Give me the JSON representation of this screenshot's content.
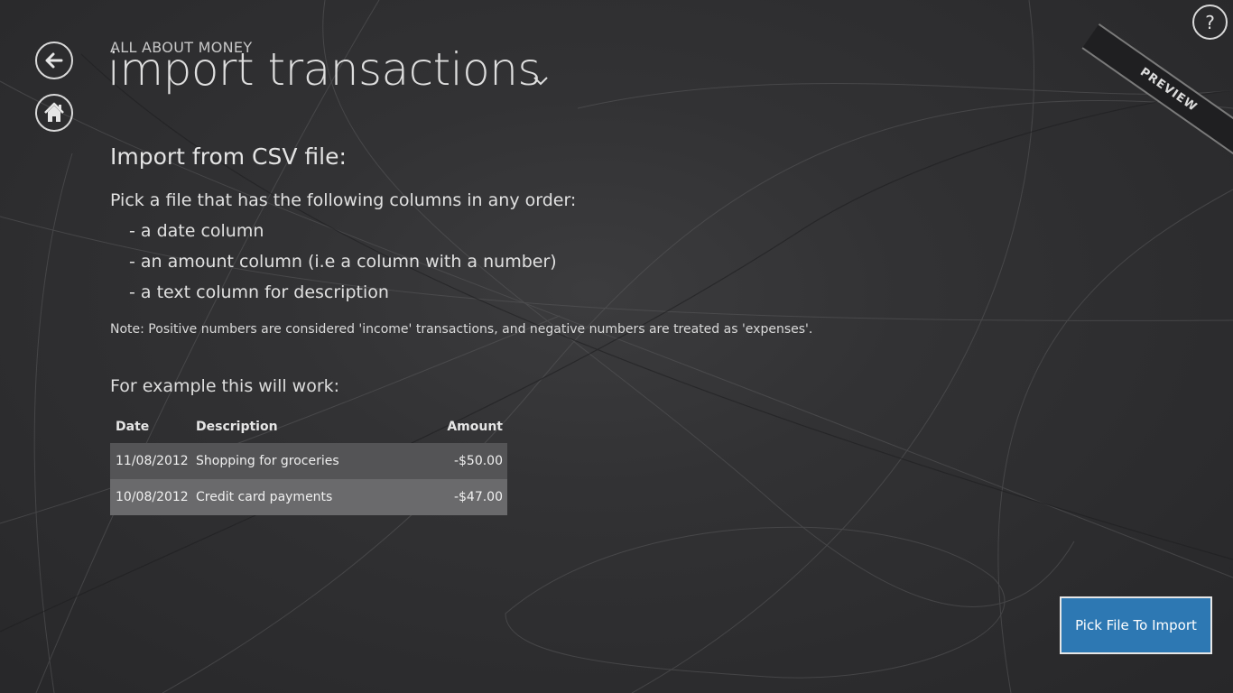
{
  "header": {
    "app_name": "ALL ABOUT MONEY",
    "title": "import transactions",
    "preview_badge": "PREVIEW",
    "help_label": "?"
  },
  "nav": {
    "back_icon": "back-arrow-icon",
    "home_icon": "home-icon",
    "title_chevron_icon": "chevron-down-icon"
  },
  "content": {
    "section_heading": "Import from CSV file:",
    "intro": "Pick a file that has the following columns in any order:",
    "requirements": [
      "- a date column",
      "- an amount column (i.e a column with a number)",
      "- a text column for description"
    ],
    "note": "Note: Positive numbers are considered 'income' transactions, and negative numbers are treated as 'expenses'.",
    "example_heading": "For example this will work:"
  },
  "example_table": {
    "headers": [
      "Date",
      "Description",
      "Amount"
    ],
    "rows": [
      [
        "11/08/2012",
        "Shopping for groceries",
        "-$50.00"
      ],
      [
        "10/08/2012",
        "Credit card payments",
        "-$47.00"
      ]
    ]
  },
  "actions": {
    "pick_file_label": "Pick File To Import"
  },
  "colors": {
    "background": "#2d2d2f",
    "accent_button": "#2d78b3",
    "table_row_1": "#545456",
    "table_row_2": "#6a6a6c"
  }
}
